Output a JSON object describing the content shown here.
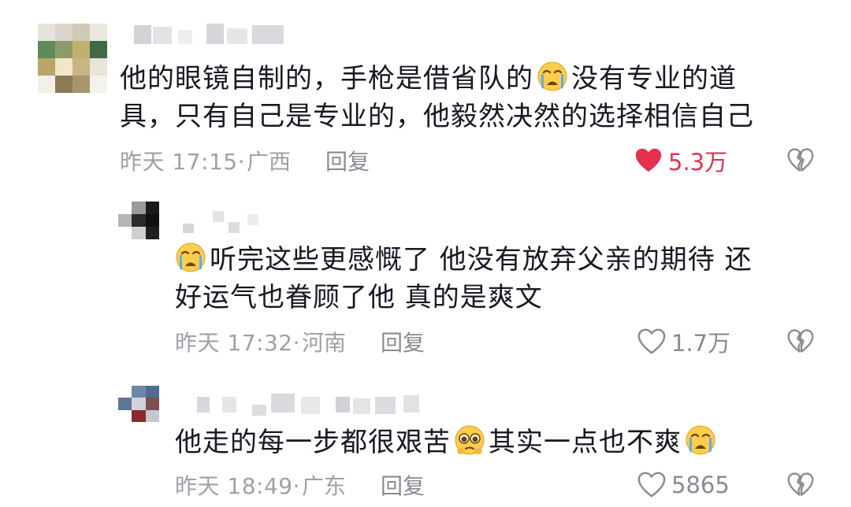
{
  "colors": {
    "text": "#161823",
    "meta": "#a0a0a8",
    "liked": "#e63050",
    "icon_outline": "#8a8a92"
  },
  "comments": [
    {
      "text_lines": [
        "他的眼镜自制的，手枪是借省队的",
        "没有专业的道",
        "具，只有自己是专业的，他毅然决然的选择相信自己"
      ],
      "emoji": "loudly-crying-face",
      "time": "昨天 17:15·",
      "location": "广西",
      "reply_label": "回复",
      "like_count": "5.3万",
      "liked": true
    },
    {
      "text_lines": [
        "听完这些更感慨了 他没有放弃父亲的期待 还",
        "好运气也眷顾了他 真的是爽文"
      ],
      "emoji": "loudly-crying-face",
      "time": "昨天 17:32·",
      "location": "河南",
      "reply_label": "回复",
      "like_count": "1.7万",
      "liked": false
    },
    {
      "text_lines": [
        "他走的每一步都很艰苦",
        "其实一点也不爽"
      ],
      "emojis": [
        "pleading-face",
        "loudly-crying-face"
      ],
      "time": "昨天 18:49·",
      "location": "广东",
      "reply_label": "回复",
      "like_count": "5865",
      "liked": false
    }
  ]
}
